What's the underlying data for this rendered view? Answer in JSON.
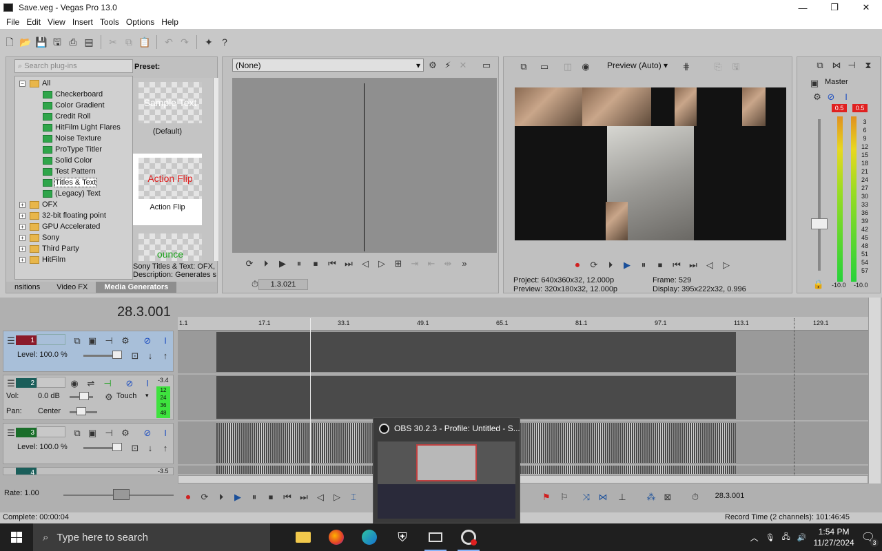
{
  "window": {
    "title": "Save.veg - Vegas Pro 13.0",
    "min": "—",
    "max": "❐",
    "close": "✕"
  },
  "menu": [
    "File",
    "Edit",
    "View",
    "Insert",
    "Tools",
    "Options",
    "Help"
  ],
  "plugins": {
    "search_placeholder": "Search plug-ins",
    "preset_label": "Preset:",
    "tree": [
      {
        "label": "All",
        "kind": "folder",
        "expander": "−",
        "level": 0
      },
      {
        "label": "Checkerboard",
        "kind": "gen",
        "level": 1
      },
      {
        "label": "Color Gradient",
        "kind": "gen",
        "level": 1
      },
      {
        "label": "Credit Roll",
        "kind": "gen",
        "level": 1
      },
      {
        "label": "HitFilm Light Flares",
        "kind": "gen",
        "level": 1
      },
      {
        "label": "Noise Texture",
        "kind": "gen",
        "level": 1
      },
      {
        "label": "ProType Titler",
        "kind": "gen",
        "level": 1
      },
      {
        "label": "Solid Color",
        "kind": "gen",
        "level": 1
      },
      {
        "label": "Test Pattern",
        "kind": "gen",
        "level": 1
      },
      {
        "label": "Titles & Text",
        "kind": "gen",
        "level": 1,
        "selected": true
      },
      {
        "label": "(Legacy) Text",
        "kind": "gen",
        "level": 1
      },
      {
        "label": "OFX",
        "kind": "folder",
        "expander": "+",
        "level": 0
      },
      {
        "label": "32-bit floating point",
        "kind": "folder",
        "expander": "+",
        "level": 0
      },
      {
        "label": "GPU Accelerated",
        "kind": "folder",
        "expander": "+",
        "level": 0
      },
      {
        "label": "Sony",
        "kind": "folder",
        "expander": "+",
        "level": 0
      },
      {
        "label": "Third Party",
        "kind": "folder",
        "expander": "+",
        "level": 0
      },
      {
        "label": "HitFilm",
        "kind": "folder",
        "expander": "+",
        "level": 0
      }
    ],
    "presets": [
      {
        "thumb_text": "Sample Text",
        "name": "(Default)",
        "color": "#ffffff"
      },
      {
        "thumb_text": "Action Flip",
        "name": "Action Flip",
        "color": "#e02020"
      },
      {
        "thumb_text": "ounce",
        "name": "",
        "color": "#18a018"
      }
    ],
    "desc_line1": "Sony Titles & Text: OFX,",
    "desc_line2": "Description: Generates s",
    "tabs": [
      "nsitions",
      "Video FX",
      "Media Generators"
    ]
  },
  "trimmer": {
    "selection": "(None)",
    "time": "1.3.021"
  },
  "preview": {
    "quality": "Preview (Auto)",
    "project_line": "Project:   640x360x32, 12.000p",
    "preview_line": "Preview:  320x180x32, 12.000p",
    "frame_line": "Frame:      529",
    "display_line": "Display:    395x222x32, 0.996"
  },
  "mixer": {
    "master_label": "Master",
    "peak_left": "0.5",
    "peak_right": "0.5",
    "scale": [
      "3",
      "6",
      "9",
      "12",
      "15",
      "18",
      "21",
      "24",
      "27",
      "30",
      "33",
      "36",
      "39",
      "42",
      "45",
      "48",
      "51",
      "54",
      "57"
    ],
    "bottom_left": "-10.0",
    "bottom_right": "-10.0"
  },
  "timeline": {
    "cursor_time": "28.3.001",
    "ruler": [
      "1.1",
      "17.1",
      "33.1",
      "49.1",
      "65.1",
      "81.1",
      "97.1",
      "113.1",
      "129.1"
    ],
    "tracks": [
      {
        "num": "1",
        "type": "video",
        "label": "Level: 100.0 %"
      },
      {
        "num": "2",
        "type": "audio",
        "vol": "Vol:",
        "vol_value": "0.0 dB",
        "pan": "Pan:",
        "pan_value": "Center",
        "mode": "Touch",
        "meter_top": "-3.4",
        "meter_scale": [
          "12",
          "24",
          "36",
          "48"
        ]
      },
      {
        "num": "3",
        "type": "video",
        "label": "Level: 100.0 %"
      },
      {
        "num": "4",
        "type": "audio",
        "meter_top": "-3.5"
      }
    ],
    "rate": "Rate: 1.00",
    "end_time": "28.3.001"
  },
  "status": {
    "left": "Complete: 00:00:04",
    "right": "Record Time (2 channels): 101:46:45"
  },
  "obs": {
    "title": "OBS 30.2.3 - Profile: Untitled - S..."
  },
  "taskbar": {
    "search": "Type here to search",
    "time": "1:54 PM",
    "date": "11/27/2024",
    "notifications": "3"
  }
}
